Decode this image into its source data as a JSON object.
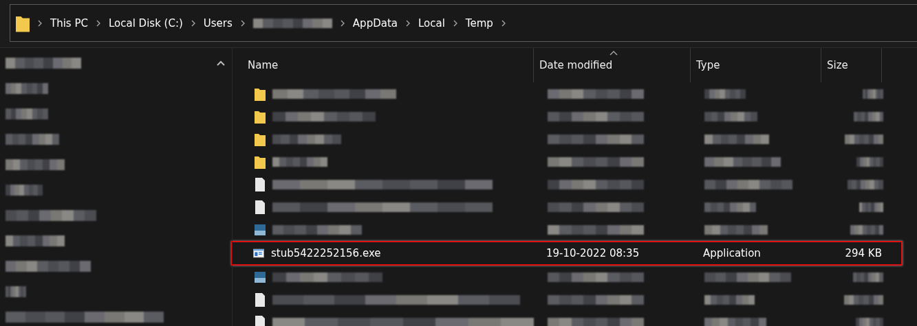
{
  "address_bar": {
    "crumbs": [
      {
        "kind": "text",
        "label": "This PC"
      },
      {
        "kind": "text",
        "label": "Local Disk (C:)"
      },
      {
        "kind": "text",
        "label": "Users"
      },
      {
        "kind": "redacted"
      },
      {
        "kind": "text",
        "label": "AppData"
      },
      {
        "kind": "text",
        "label": "Local"
      },
      {
        "kind": "text",
        "label": "Temp"
      }
    ]
  },
  "sidebar": {
    "items": [
      {
        "kind": "redacted"
      },
      {
        "kind": "redacted"
      },
      {
        "kind": "redacted"
      },
      {
        "kind": "redacted"
      },
      {
        "kind": "redacted"
      },
      {
        "kind": "redacted"
      },
      {
        "kind": "redacted"
      },
      {
        "kind": "redacted"
      },
      {
        "kind": "redacted"
      },
      {
        "kind": "redacted"
      },
      {
        "kind": "redacted"
      }
    ]
  },
  "table": {
    "columns": [
      {
        "label": "Name",
        "sorted": false
      },
      {
        "label": "Date modified",
        "sorted": true
      },
      {
        "label": "Type",
        "sorted": false
      },
      {
        "label": "Size",
        "sorted": false
      }
    ],
    "rows": [
      {
        "kind": "folder",
        "highlighted": false
      },
      {
        "kind": "folder",
        "highlighted": false
      },
      {
        "kind": "folder",
        "highlighted": false
      },
      {
        "kind": "folder",
        "highlighted": false
      },
      {
        "kind": "file",
        "highlighted": false
      },
      {
        "kind": "file",
        "highlighted": false
      },
      {
        "kind": "image",
        "highlighted": false
      },
      {
        "kind": "app",
        "name": "stub5422252156.exe",
        "date": "19-10-2022 08:35",
        "type": "Application",
        "size": "294 KB",
        "highlighted": true
      },
      {
        "kind": "image",
        "highlighted": false
      },
      {
        "kind": "file",
        "highlighted": false
      },
      {
        "kind": "file",
        "highlighted": false
      }
    ]
  }
}
